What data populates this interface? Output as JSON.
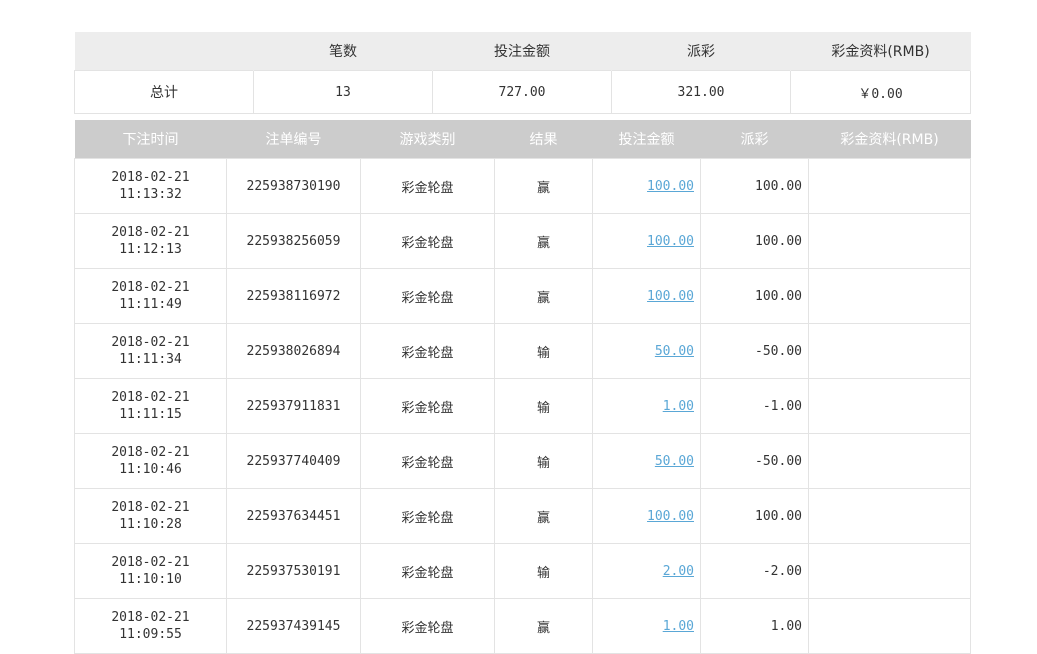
{
  "summary": {
    "headers": [
      "",
      "笔数",
      "投注金额",
      "派彩",
      "彩金资料(RMB)"
    ],
    "row": {
      "label": "总计",
      "count": "13",
      "bet_amount": "727.00",
      "payout": "321.00",
      "jackpot": "￥0.00"
    }
  },
  "records": {
    "headers": [
      "下注时间",
      "注单编号",
      "游戏类别",
      "结果",
      "投注金额",
      "派彩",
      "彩金资料(RMB)"
    ],
    "rows": [
      {
        "date": "2018-02-21",
        "time": "11:13:32",
        "id": "225938730190",
        "game": "彩金轮盘",
        "result": "赢",
        "bet": "100.00",
        "payout": "100.00",
        "jackpot": ""
      },
      {
        "date": "2018-02-21",
        "time": "11:12:13",
        "id": "225938256059",
        "game": "彩金轮盘",
        "result": "赢",
        "bet": "100.00",
        "payout": "100.00",
        "jackpot": ""
      },
      {
        "date": "2018-02-21",
        "time": "11:11:49",
        "id": "225938116972",
        "game": "彩金轮盘",
        "result": "赢",
        "bet": "100.00",
        "payout": "100.00",
        "jackpot": ""
      },
      {
        "date": "2018-02-21",
        "time": "11:11:34",
        "id": "225938026894",
        "game": "彩金轮盘",
        "result": "输",
        "bet": "50.00",
        "payout": "-50.00",
        "jackpot": ""
      },
      {
        "date": "2018-02-21",
        "time": "11:11:15",
        "id": "225937911831",
        "game": "彩金轮盘",
        "result": "输",
        "bet": "1.00",
        "payout": "-1.00",
        "jackpot": ""
      },
      {
        "date": "2018-02-21",
        "time": "11:10:46",
        "id": "225937740409",
        "game": "彩金轮盘",
        "result": "输",
        "bet": "50.00",
        "payout": "-50.00",
        "jackpot": ""
      },
      {
        "date": "2018-02-21",
        "time": "11:10:28",
        "id": "225937634451",
        "game": "彩金轮盘",
        "result": "赢",
        "bet": "100.00",
        "payout": "100.00",
        "jackpot": ""
      },
      {
        "date": "2018-02-21",
        "time": "11:10:10",
        "id": "225937530191",
        "game": "彩金轮盘",
        "result": "输",
        "bet": "2.00",
        "payout": "-2.00",
        "jackpot": ""
      },
      {
        "date": "2018-02-21",
        "time": "11:09:55",
        "id": "225937439145",
        "game": "彩金轮盘",
        "result": "赢",
        "bet": "1.00",
        "payout": "1.00",
        "jackpot": ""
      }
    ]
  },
  "colors": {
    "negative": "#cc0000",
    "link": "#5aa7d6",
    "header_bg": "#cccccc",
    "summary_header_bg": "#ededed"
  }
}
